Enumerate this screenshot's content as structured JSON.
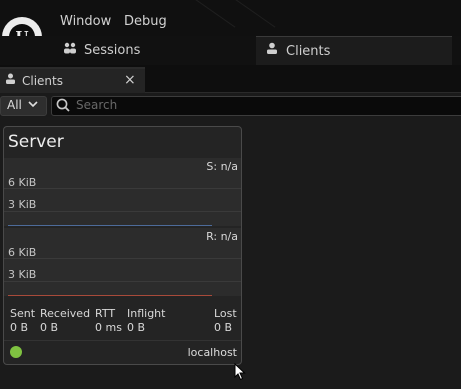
{
  "menu": {
    "window": "Window",
    "debug": "Debug"
  },
  "logo_letter": "U",
  "major_tabs": [
    {
      "label": "Sessions",
      "icon": "sessions-icon",
      "active": false
    },
    {
      "label": "Clients",
      "icon": "clients-icon",
      "active": true
    }
  ],
  "panel_tab": {
    "label": "Clients",
    "icon": "clients-icon",
    "close_glyph": "×"
  },
  "filter": {
    "selected": "All",
    "search_placeholder": "Search",
    "search_value": ""
  },
  "card": {
    "title": "Server",
    "sent_graph": {
      "right_label": "S: n/a",
      "axis_labels": [
        "6 KiB",
        "3 KiB"
      ],
      "baseline_color": "#4d6b9a"
    },
    "received_graph": {
      "right_label": "R: n/a",
      "axis_labels": [
        "6 KiB",
        "3 KiB"
      ],
      "baseline_color": "#a84a3a"
    },
    "stats": {
      "headers": [
        "Sent",
        "Received",
        "RTT",
        "Inflight",
        "Lost"
      ],
      "values": [
        "0 B",
        "0 B",
        "0 ms",
        "0 B",
        "0 B"
      ]
    },
    "status_color": "#7fc241",
    "host": "localhost"
  },
  "colors": {
    "background": "#151515",
    "panel": "#242424",
    "accent_status": "#7fc241"
  }
}
